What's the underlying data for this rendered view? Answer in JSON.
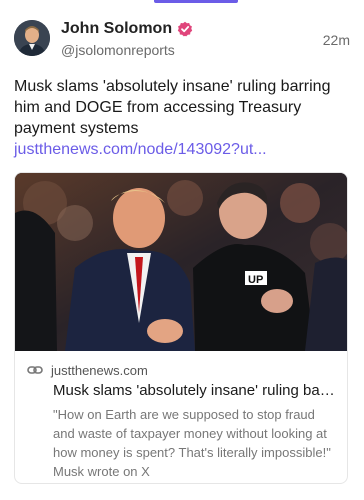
{
  "post": {
    "author": {
      "display_name": "John Solomon",
      "handle": "@jsolomonreports",
      "verified": true
    },
    "timestamp": "22m",
    "text": "Musk slams 'absolutely insane' ruling barring him and DOGE from accessing Treasury payment systems ",
    "link_text": "justthenews.com/node/143092?ut..."
  },
  "link_card": {
    "domain": "justthenews.com",
    "title": "Musk slams 'absolutely insane' ruling barring him and DOGE from accessing Treasury payment systems",
    "description": "\"How on Earth are we supposed to stop fraud and waste of taxpayer money without looking at how money is spent? That's literally impossible!\" Musk wrote on X"
  },
  "colors": {
    "accent": "#6b5ce7",
    "verified_badge": "#e0457b",
    "muted_text": "#6a6a6a"
  },
  "icons": {
    "verified": "verified-badge-icon",
    "link": "link-icon"
  }
}
